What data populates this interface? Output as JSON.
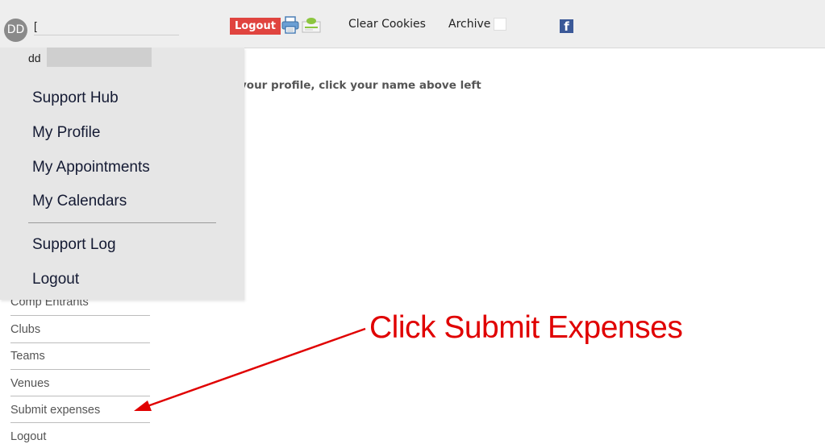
{
  "header": {
    "avatar_initials": "DD",
    "username_visible": "[",
    "logout_label": "Logout",
    "printer_icon": "printer-icon",
    "email_icon": "email-icon",
    "clear_cookies_label": "Clear Cookies",
    "archive_label": "Archive",
    "facebook_icon": "facebook-icon",
    "facebook_glyph": "f"
  },
  "main": {
    "profile_message": "your profile, click your name above left"
  },
  "user_dropdown": {
    "username_prefix": "dd",
    "items": [
      {
        "label": "Support Hub"
      },
      {
        "label": "My Profile"
      },
      {
        "label": "My Appointments"
      },
      {
        "label": "My Calendars"
      },
      {
        "label": "Support Log"
      },
      {
        "label": "Logout"
      }
    ]
  },
  "side_menu": {
    "items": [
      {
        "label": "Comp Entrants"
      },
      {
        "label": "Clubs"
      },
      {
        "label": "Teams"
      },
      {
        "label": "Venues"
      },
      {
        "label": "Submit expenses"
      },
      {
        "label": "Logout"
      }
    ]
  },
  "annotation": {
    "text": "Click Submit Expenses",
    "color": "#e00000"
  },
  "colors": {
    "logout_button": "#e0443f",
    "facebook": "#3b5998",
    "topbar": "#eeeeee"
  }
}
